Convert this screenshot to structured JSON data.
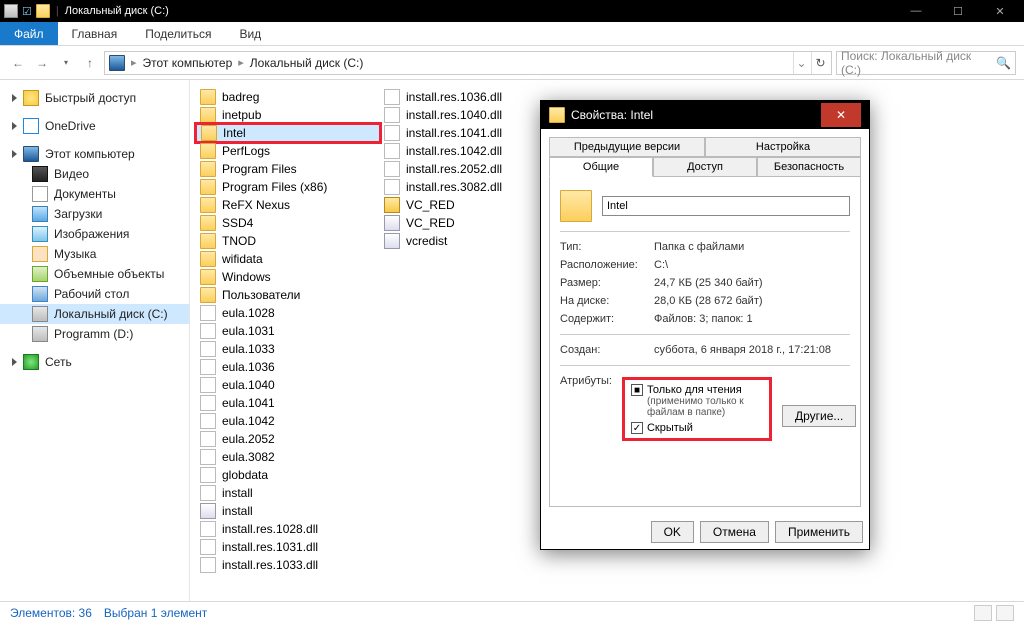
{
  "titlebar": {
    "title": "Локальный диск (C:)"
  },
  "winctl": {
    "min": "—",
    "max": "☐",
    "close": "✕"
  },
  "ribbon": {
    "file": "Файл",
    "tab_home": "Главная",
    "tab_share": "Поделиться",
    "tab_view": "Вид"
  },
  "nav": {
    "back": "←",
    "fwd": "→",
    "up": "↑",
    "chev": "▸",
    "down": "⌄",
    "refresh": "↻"
  },
  "breadcrumb": {
    "root": "Этот компьютер",
    "path": "Локальный диск (C:)"
  },
  "search": {
    "placeholder": "Поиск: Локальный диск (C:)",
    "icon": "🔍"
  },
  "sidebar": {
    "quick": "Быстрый доступ",
    "onedrive": "OneDrive",
    "this_pc": "Этот компьютер",
    "video": "Видео",
    "docs": "Документы",
    "downloads": "Загрузки",
    "pictures": "Изображения",
    "music": "Музыка",
    "objects3d": "Объемные объекты",
    "desktop": "Рабочий стол",
    "drive_c": "Локальный диск (C:)",
    "drive_d": "Programm (D:)",
    "network": "Сеть"
  },
  "files": {
    "col1": [
      "badreg",
      "inetpub",
      "Intel",
      "PerfLogs",
      "Program Files",
      "Program Files (x86)",
      "ReFX Nexus",
      "SSD4",
      "TNOD",
      "wifidata",
      "Windows",
      "Пользователи",
      "eula.1028",
      "eula.1031",
      "eula.1033",
      "eula.1036",
      "eula.1040",
      "eula.1041",
      "eula.1042",
      "eula.2052",
      "eula.3082",
      "globdata",
      "install",
      "install",
      "install.res.1028.dll",
      "install.res.1031.dll",
      "install.res.1033.dll"
    ],
    "col2": [
      "install.res.1036.dll",
      "install.res.1040.dll",
      "install.res.1041.dll",
      "install.res.1042.dll",
      "install.res.2052.dll",
      "install.res.3082.dll",
      "VC_RED",
      "VC_RED",
      "vcredist"
    ]
  },
  "status": {
    "count": "Элементов: 36",
    "selected": "Выбран 1 элемент"
  },
  "dialog": {
    "title": "Свойства: Intel",
    "tabs": {
      "prev": "Предыдущие версии",
      "custom": "Настройка",
      "general": "Общие",
      "sharing": "Доступ",
      "security": "Безопасность"
    },
    "name": "Intel",
    "type_lbl": "Тип:",
    "type_val": "Папка с файлами",
    "loc_lbl": "Расположение:",
    "loc_val": "C:\\",
    "size_lbl": "Размер:",
    "size_val": "24,7 КБ (25 340 байт)",
    "disk_lbl": "На диске:",
    "disk_val": "28,0 КБ (28 672 байт)",
    "cont_lbl": "Содержит:",
    "cont_val": "Файлов: 3; папок: 1",
    "created_lbl": "Создан:",
    "created_val": "суббота, 6 января 2018 г., 17:21:08",
    "attr_lbl": "Атрибуты:",
    "readonly": "Только для чтения",
    "readonly_sub": "(применимо только к файлам в папке)",
    "hidden": "Скрытый",
    "other_btn": "Другие...",
    "ok": "OK",
    "cancel": "Отмена",
    "apply": "Применить"
  }
}
